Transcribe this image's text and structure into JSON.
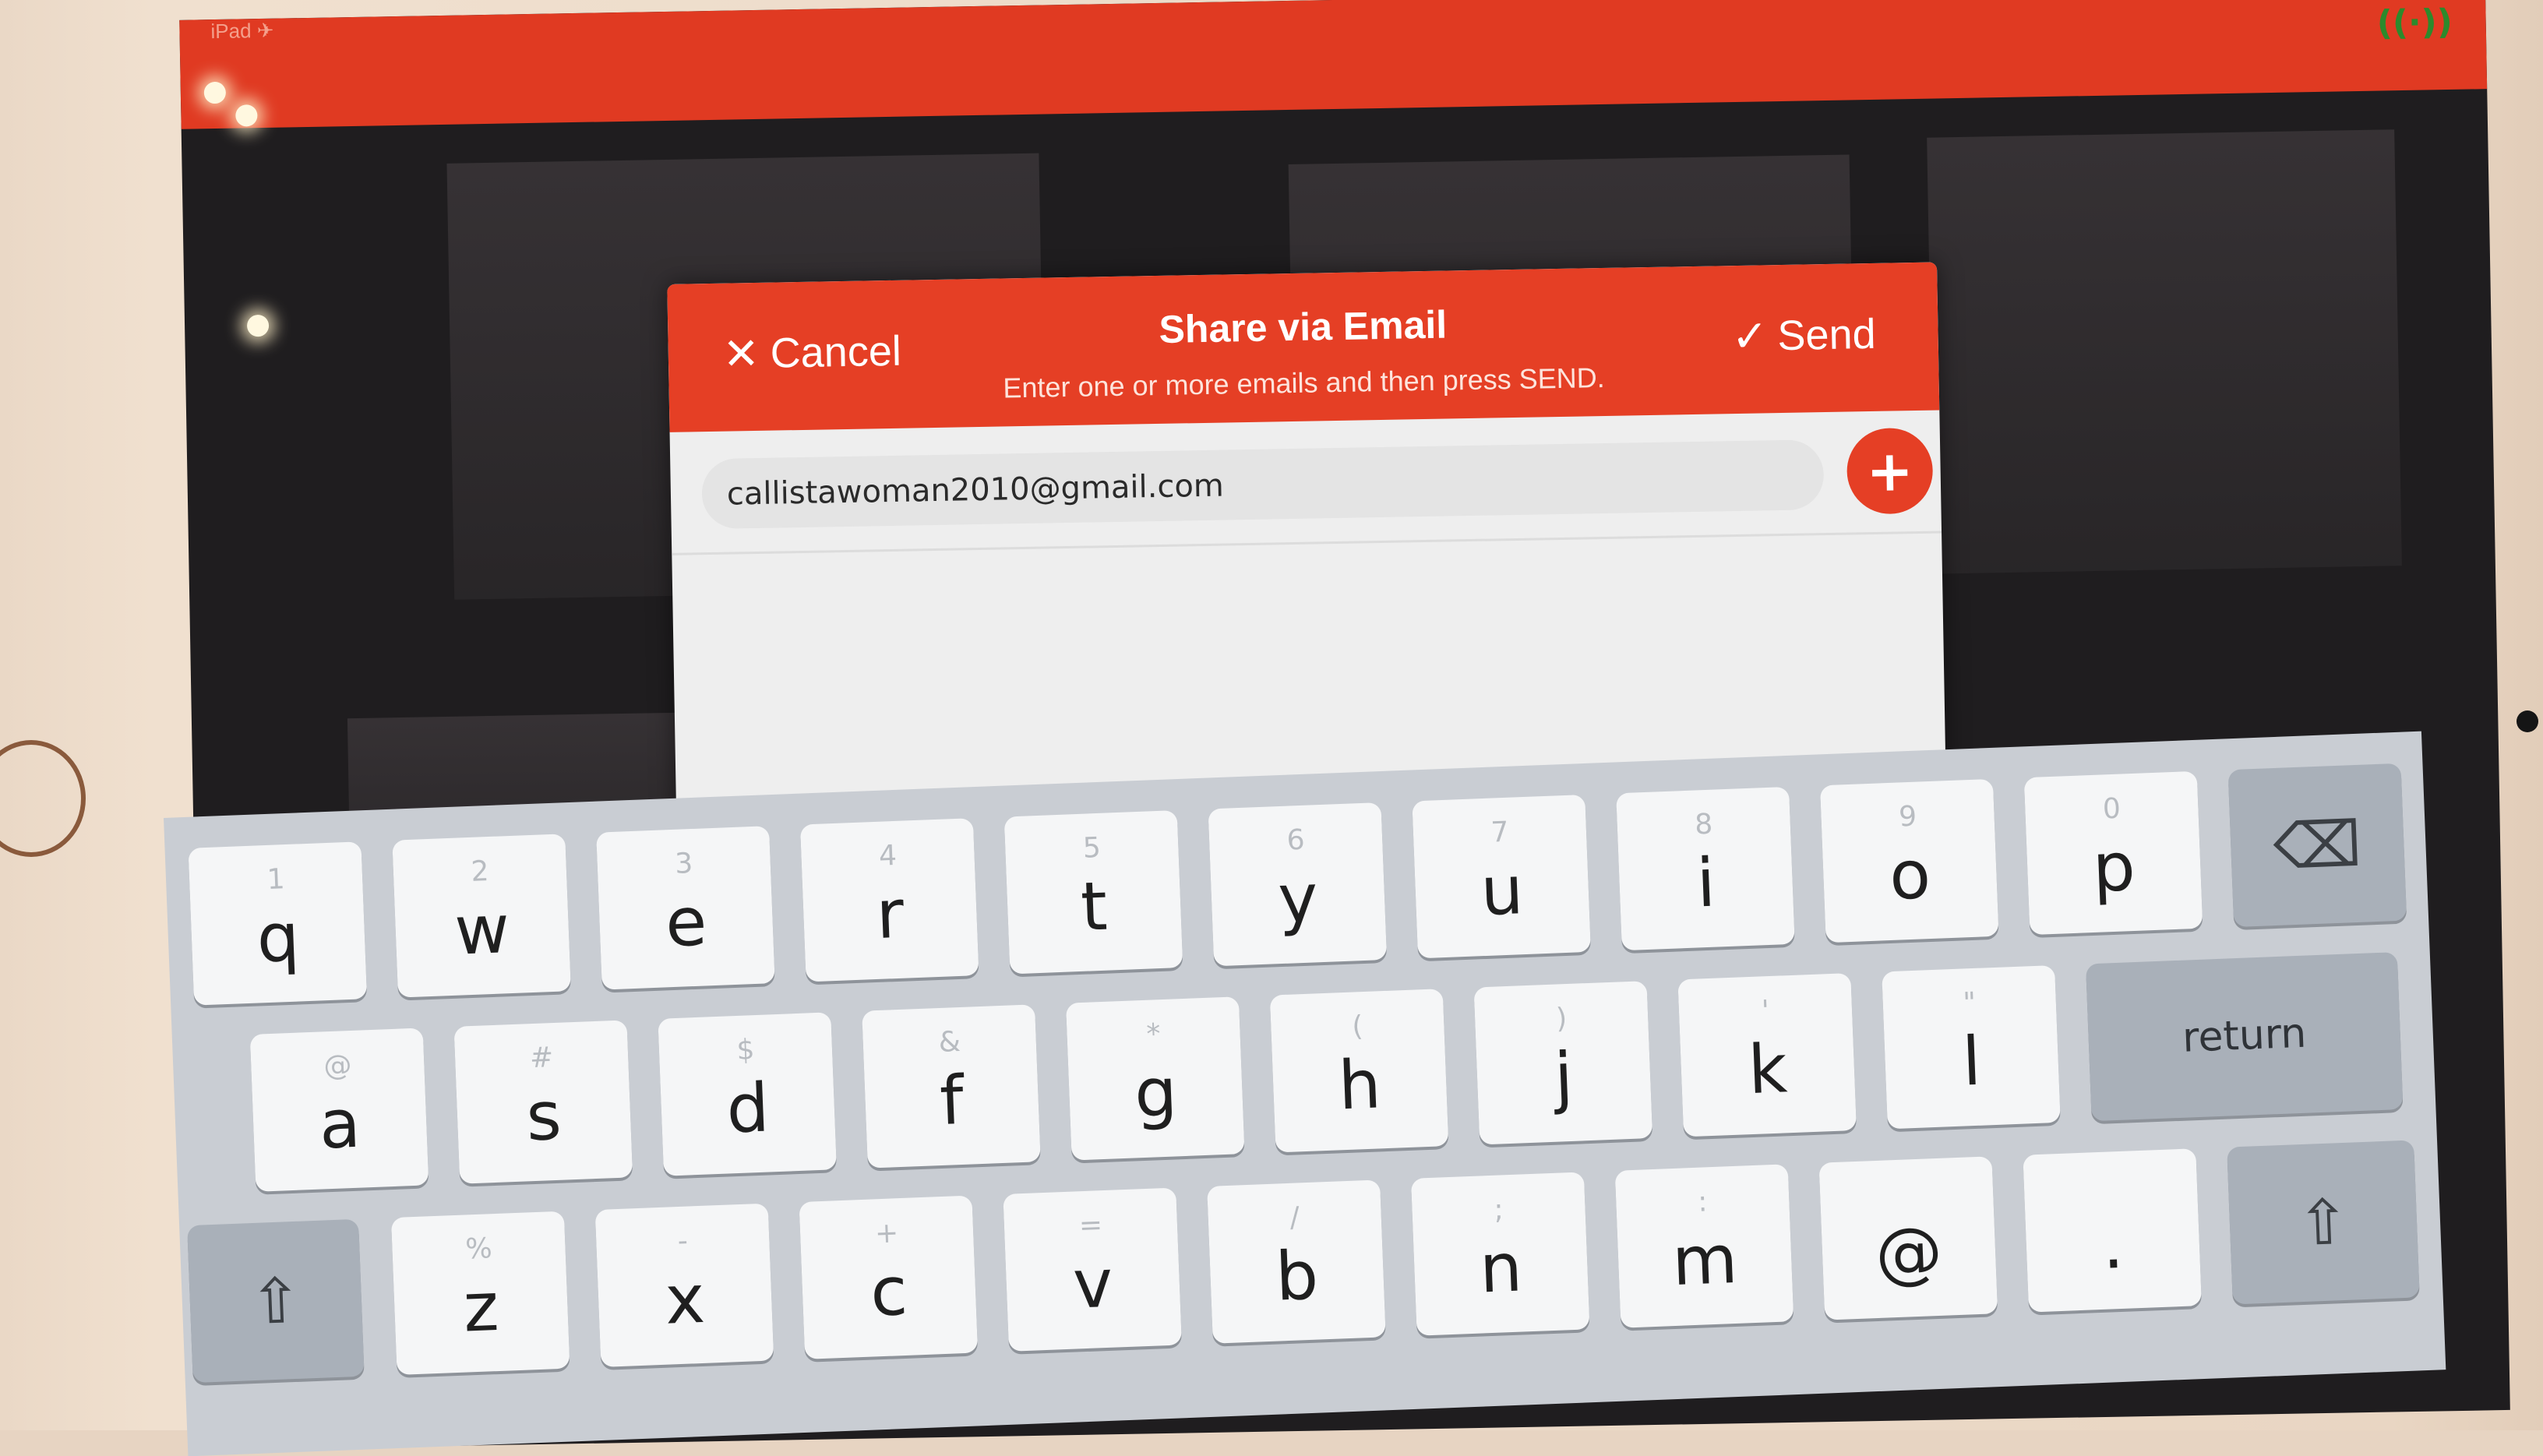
{
  "status_bar": {
    "carrier": "iPad ✈",
    "signal_icon": "((·))"
  },
  "dialog": {
    "title": "Share via Email",
    "subtitle": "Enter one or more emails and then press SEND.",
    "cancel_label": "Cancel",
    "cancel_icon": "close-icon",
    "send_label": "Send",
    "send_icon": "checkmark-icon",
    "email_value": "callistawoman2010@gmail.com",
    "add_icon": "plus-icon"
  },
  "keyboard": {
    "row1": [
      {
        "letter": "q",
        "hint": "1"
      },
      {
        "letter": "w",
        "hint": "2"
      },
      {
        "letter": "e",
        "hint": "3"
      },
      {
        "letter": "r",
        "hint": "4"
      },
      {
        "letter": "t",
        "hint": "5"
      },
      {
        "letter": "y",
        "hint": "6"
      },
      {
        "letter": "u",
        "hint": "7"
      },
      {
        "letter": "i",
        "hint": "8"
      },
      {
        "letter": "o",
        "hint": "9"
      },
      {
        "letter": "p",
        "hint": "0"
      }
    ],
    "row2": [
      {
        "letter": "a",
        "hint": "@"
      },
      {
        "letter": "s",
        "hint": "#"
      },
      {
        "letter": "d",
        "hint": "$"
      },
      {
        "letter": "f",
        "hint": "&"
      },
      {
        "letter": "g",
        "hint": "*"
      },
      {
        "letter": "h",
        "hint": "("
      },
      {
        "letter": "j",
        "hint": ")"
      },
      {
        "letter": "k",
        "hint": "'"
      },
      {
        "letter": "l",
        "hint": "\""
      }
    ],
    "row3": [
      {
        "letter": "z",
        "hint": "%"
      },
      {
        "letter": "x",
        "hint": "-"
      },
      {
        "letter": "c",
        "hint": "+"
      },
      {
        "letter": "v",
        "hint": "="
      },
      {
        "letter": "b",
        "hint": "/"
      },
      {
        "letter": "n",
        "hint": ";"
      },
      {
        "letter": "m",
        "hint": ":"
      },
      {
        "letter": "@",
        "hint": ""
      },
      {
        "letter": ".",
        "hint": ""
      }
    ],
    "return_label": "return",
    "delete_icon": "⌫",
    "shift_icon": "⇧"
  }
}
